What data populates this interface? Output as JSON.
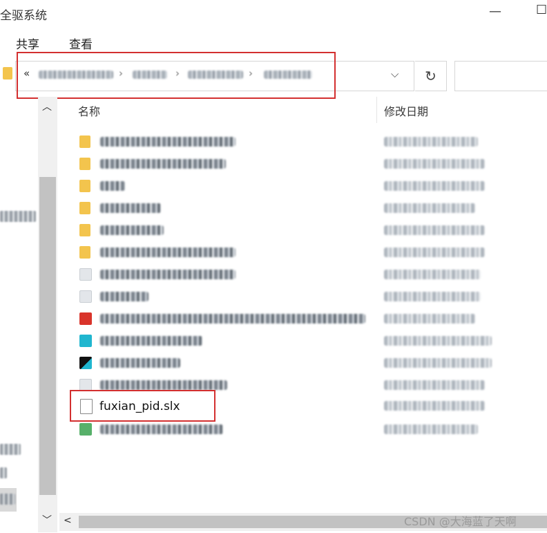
{
  "window": {
    "title": "全驱系统"
  },
  "menu": {
    "share": "共享",
    "view": "查看"
  },
  "address_bar": {
    "overflow_chevron": "«"
  },
  "columns": {
    "name": "名称",
    "modified": "修改日期"
  },
  "files": {
    "visible_file": {
      "name": "fuxian_pid.slx"
    }
  },
  "watermark": "CSDN @大海蓝了天啊",
  "icons": {
    "minimize": "minimize-icon",
    "maximize": "maximize-icon",
    "refresh": "refresh-icon",
    "dropdown": "chevron-down-icon"
  },
  "colors": {
    "highlight": "#d32f2f",
    "folder": "#f3c44d"
  }
}
